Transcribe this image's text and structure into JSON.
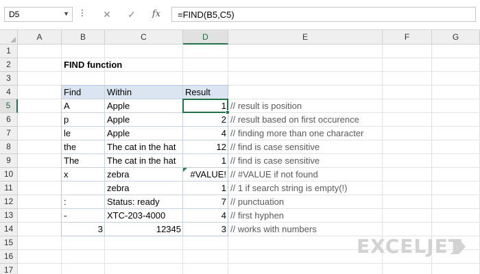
{
  "formula_bar": {
    "name_box": "D5",
    "cancel_glyph": "✕",
    "enter_glyph": "✓",
    "fx_label": "fx",
    "formula": "=FIND(B5,C5)"
  },
  "columns": [
    "A",
    "B",
    "C",
    "D",
    "E",
    "F",
    "G"
  ],
  "rows": [
    "1",
    "2",
    "3",
    "4",
    "5",
    "6",
    "7",
    "8",
    "9",
    "10",
    "11",
    "12",
    "13",
    "14",
    "15",
    "16",
    "17"
  ],
  "active_cell": {
    "column": "D",
    "row": "5"
  },
  "title": "FIND function",
  "table": {
    "headers": {
      "find": "Find",
      "within": "Within",
      "result": "Result"
    },
    "rows": [
      {
        "find": "A",
        "within": "Apple",
        "result": "1",
        "comment": "// result is position"
      },
      {
        "find": "p",
        "within": "Apple",
        "result": "2",
        "comment": "// result based on first occurence"
      },
      {
        "find": "le",
        "within": "Apple",
        "result": "4",
        "comment": "// finding more than one character"
      },
      {
        "find": "the",
        "within": "The cat in the hat",
        "result": "12",
        "comment": "// find is case sensitive"
      },
      {
        "find": "The",
        "within": "The cat in the hat",
        "result": "1",
        "comment": "// find is case sensitive"
      },
      {
        "find": "x",
        "within": "zebra",
        "result": "#VALUE!",
        "comment": "// #VALUE if not found"
      },
      {
        "find": "",
        "within": "zebra",
        "result": "1",
        "comment": "// 1 if search string is empty(!)"
      },
      {
        "find": ":",
        "within": "Status: ready",
        "result": "7",
        "comment": "// punctuation"
      },
      {
        "find": "-",
        "within": "XTC-203-4000",
        "result": "4",
        "comment": "// first hyphen"
      },
      {
        "find": "3",
        "within": "12345",
        "result": "3",
        "comment": "// works with numbers",
        "numeric": true
      }
    ]
  },
  "logo_text": "EXCELJET",
  "colors": {
    "selection": "#217346",
    "table_header": "#dbe5f1",
    "comment_text": "#595959"
  }
}
